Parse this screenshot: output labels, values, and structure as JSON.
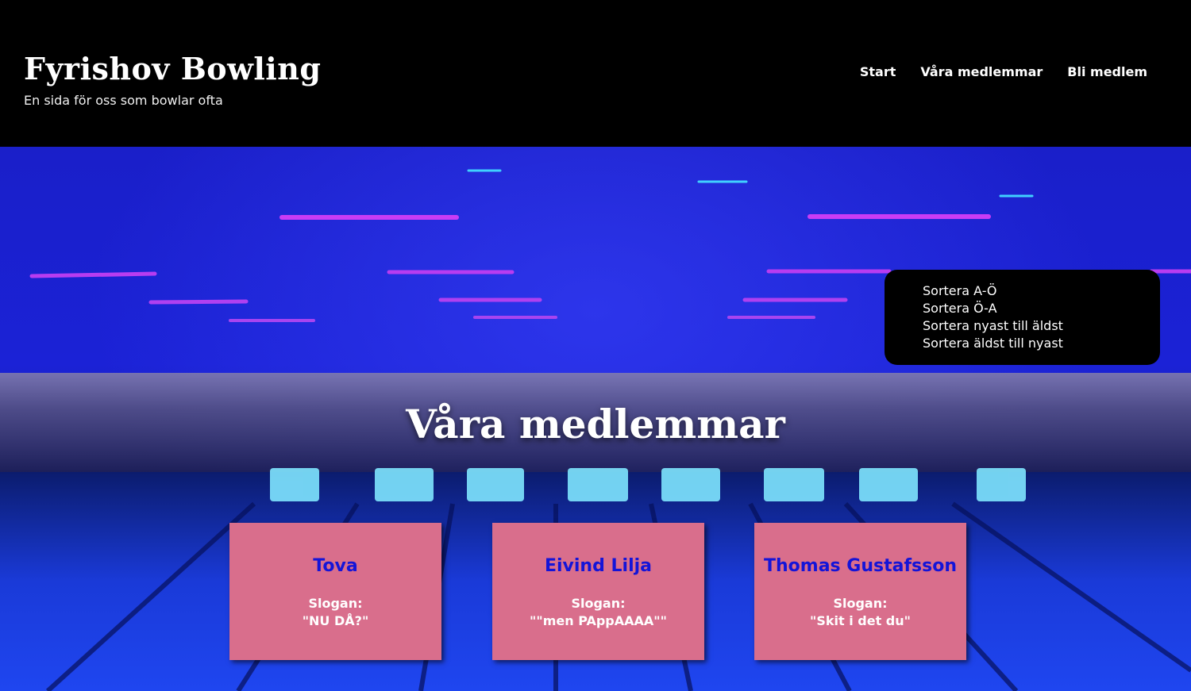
{
  "header": {
    "title": "Fyrishov Bowling",
    "tagline": "En sida för oss som bowlar ofta",
    "nav": [
      {
        "label": "Start"
      },
      {
        "label": "Våra medlemmar"
      },
      {
        "label": "Bli medlem"
      }
    ]
  },
  "main": {
    "heading": "Våra medlemmar",
    "sort_options": [
      {
        "label": "Sortera A-Ö"
      },
      {
        "label": "Sortera Ö-A"
      },
      {
        "label": "Sortera nyast till äldst"
      },
      {
        "label": "Sortera äldst till nyast"
      }
    ],
    "members": [
      {
        "name": "Tova",
        "slogan_label": "Slogan:",
        "slogan": "\"NU DÅ?\""
      },
      {
        "name": "Eivind Lilja",
        "slogan_label": "Slogan:",
        "slogan": "\"\"men PAppAAAA\"\""
      },
      {
        "name": "Thomas Gustafsson",
        "slogan_label": "Slogan:",
        "slogan": "\"Skit i det du\""
      }
    ]
  },
  "colors": {
    "header_bg": "#000000",
    "card_bg": "#d96e8c",
    "card_name": "#1414d8",
    "hero_blue": "#1b22d6"
  }
}
